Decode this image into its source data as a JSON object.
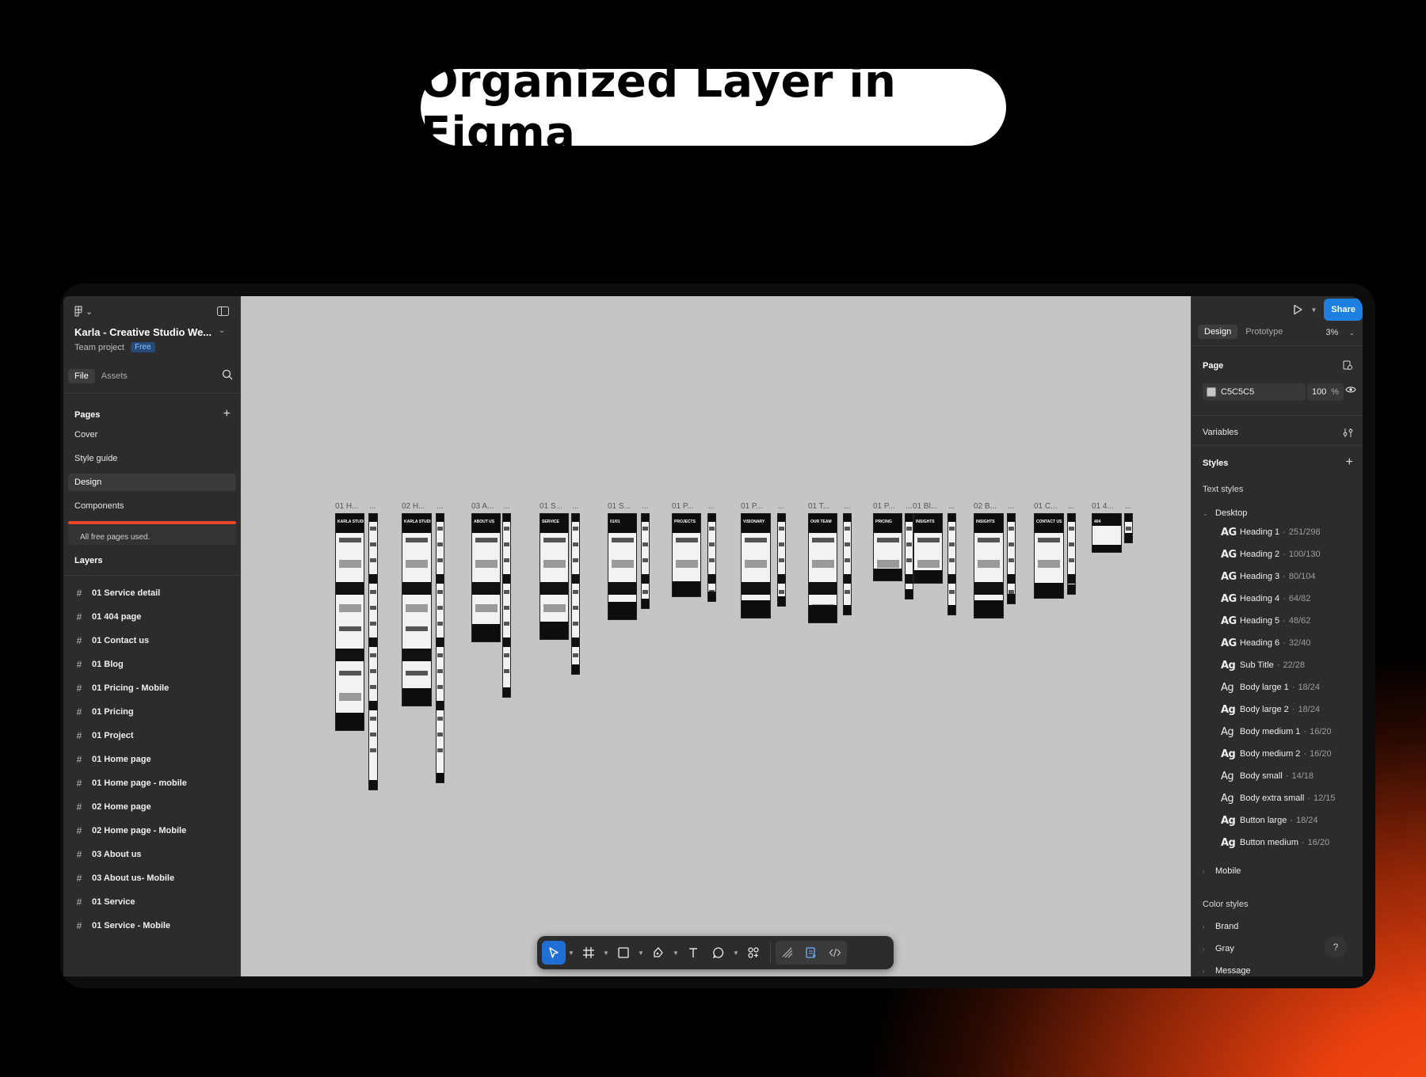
{
  "headline": "Organized Layer in Figma",
  "left_panel": {
    "file_title": "Karla - Creative Studio We...",
    "team": "Team project",
    "plan_badge": "Free",
    "tabs": [
      "File",
      "Assets"
    ],
    "pages_heading": "Pages",
    "pages": [
      "Cover",
      "Style guide",
      "Design",
      "Components"
    ],
    "active_page": "Design",
    "free_pages_note": "All free pages used.",
    "layers_heading": "Layers",
    "layers": [
      "01 Service detail",
      "01 404 page",
      "01 Contact us",
      "01 Blog",
      "01 Pricing - Mobile",
      "01 Pricing",
      "01 Project",
      "01 Home page",
      "01 Home page - mobile",
      "02 Home page",
      "02 Home page - Mobile",
      "03 About us",
      "03 About us- Mobile",
      "01 Service",
      "01 Service - Mobile"
    ]
  },
  "canvas": {
    "background": "#C5C5C5",
    "frame_labels": [
      "01 H...",
      "02 H...",
      "03 A...",
      "01 S...",
      "01 S...",
      "01 P...",
      "01 P...",
      "01 T...",
      "01 P...",
      "01 Bl...",
      "02 B...",
      "01 C...",
      "01 4..."
    ],
    "mobile_label": "...",
    "frame_titles": [
      "KARLA STUDIO",
      "KARLA STUDIO",
      "ABOUT US",
      "SERVICE",
      "01/01",
      "PROJECTS",
      "VISIONARY",
      "OUR TEAM",
      "PRICING",
      "INSIGHTS",
      "INSIGHTS",
      "CONTACT US",
      "404"
    ]
  },
  "toolbar": {
    "tools": [
      "move-tool",
      "frame-tool",
      "shape-tool",
      "pen-tool",
      "text-tool",
      "comment-tool",
      "actions-tool",
      "draw-mode",
      "design-mode",
      "dev-mode"
    ]
  },
  "right_panel": {
    "share": "Share",
    "tabs": [
      "Design",
      "Prototype"
    ],
    "zoom": "3%",
    "page_heading": "Page",
    "page_color": "C5C5C5",
    "page_opacity": "100",
    "percent_sign": "%",
    "variables": "Variables",
    "styles_heading": "Styles",
    "text_styles_heading": "Text styles",
    "desktop_group": "Desktop",
    "text_styles": [
      {
        "name": "Heading 1",
        "meta": "251/298"
      },
      {
        "name": "Heading 2",
        "meta": "100/130"
      },
      {
        "name": "Heading 3",
        "meta": "80/104"
      },
      {
        "name": "Heading 4",
        "meta": "64/82"
      },
      {
        "name": "Heading 5",
        "meta": "48/62"
      },
      {
        "name": "Heading 6",
        "meta": "32/40"
      },
      {
        "name": "Sub Title",
        "meta": "22/28"
      },
      {
        "name": "Body large 1",
        "meta": "18/24"
      },
      {
        "name": "Body large 2",
        "meta": "18/24"
      },
      {
        "name": "Body medium 1",
        "meta": "16/20"
      },
      {
        "name": "Body medium 2",
        "meta": "16/20"
      },
      {
        "name": "Body small",
        "meta": "14/18"
      },
      {
        "name": "Body extra small",
        "meta": "12/15"
      },
      {
        "name": "Button large",
        "meta": "18/24"
      },
      {
        "name": "Button medium",
        "meta": "16/20"
      }
    ],
    "mobile_group": "Mobile",
    "color_styles_heading": "Color styles",
    "color_groups": [
      "Brand",
      "Gray",
      "Message"
    ],
    "ag_glyph_caps": "AG",
    "ag_glyph": "Ag",
    "help": "?"
  },
  "colors": {
    "accent": "#1D7FE0",
    "warning_bar": "#E8482A",
    "glow": "#FF4E12"
  }
}
